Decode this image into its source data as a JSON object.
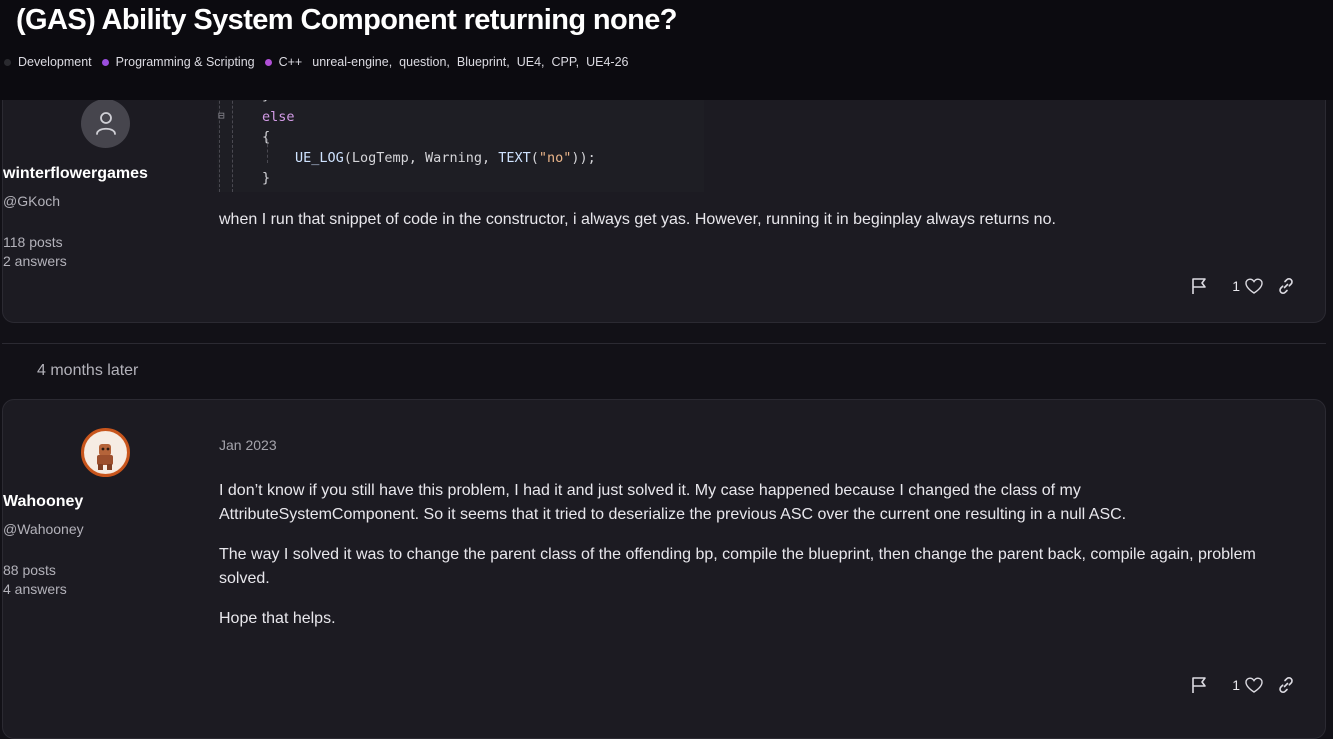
{
  "topic": {
    "title": "(GAS) Ability System Component returning none?",
    "categories": [
      {
        "label": "Development",
        "color": "#2a2a2f"
      },
      {
        "label": "Programming & Scripting",
        "color": "#9b4ede"
      },
      {
        "label": "C++",
        "color": "#b04fd6"
      }
    ],
    "tags": [
      "unreal-engine,",
      "question,",
      "Blueprint,",
      "UE4,",
      "CPP,",
      "UE4-26"
    ]
  },
  "post1": {
    "author_name": "winterflowergames",
    "author_handle": "@GKoch",
    "posts": "118 posts",
    "answers": "2 answers",
    "code": {
      "line_brace_close": "}",
      "line_else": "else",
      "line_brace_open": "{",
      "line_log_fn": "UE_LOG",
      "line_log_args1": "(LogTemp, Warning, ",
      "line_log_text": "TEXT",
      "line_log_paren": "(",
      "line_log_str": "\"no\"",
      "line_log_end": "));",
      "line_brace_end": "}"
    },
    "text": "when I run that snippet of code in the constructor, i always get yas. However, running it in beginplay always returns no.",
    "likes": "1"
  },
  "time_gap": "4 months later",
  "post2": {
    "author_name": "Wahooney",
    "author_handle": "@Wahooney",
    "posts": "88 posts",
    "answers": "4 answers",
    "date": "Jan 2023",
    "paragraphs": [
      "I don’t know if you still have this problem, I had it and just solved it. My case happened because I changed the class of my AttributeSystemComponent. So it seems that it tried to deserialize the previous ASC over the current one resulting in a null ASC.",
      "The way I solved it was to change the parent class of the offending bp, compile the blueprint, then change the parent back, compile again, problem solved.",
      "Hope that helps."
    ],
    "likes": "1"
  },
  "icons": {
    "flag": "flag-icon",
    "heart": "heart-icon",
    "link": "link-icon",
    "avatar_default": "user-icon"
  }
}
